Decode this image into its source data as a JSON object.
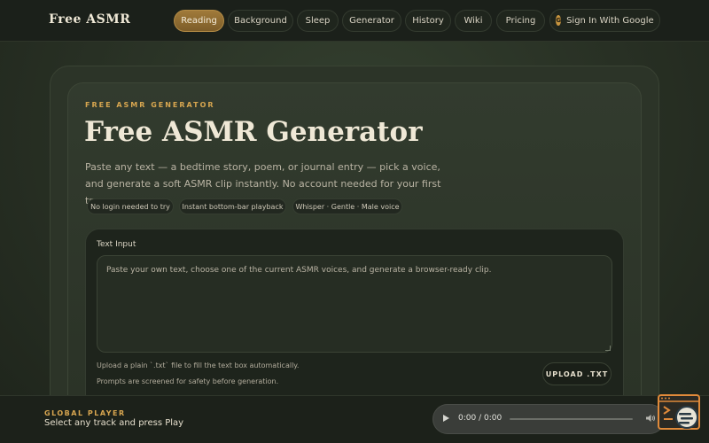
{
  "brand": "Free ASMR",
  "nav": {
    "items": [
      {
        "label": "Reading",
        "active": true
      },
      {
        "label": "Background",
        "active": false
      },
      {
        "label": "Sleep",
        "active": false
      },
      {
        "label": "Generator",
        "active": false
      },
      {
        "label": "History",
        "active": false
      },
      {
        "label": "Wiki",
        "active": false
      },
      {
        "label": "Pricing",
        "active": false
      }
    ],
    "signin": {
      "label": "Sign In With Google",
      "badge": "G"
    }
  },
  "hero": {
    "eyebrow": "FREE ASMR GENERATOR",
    "title": "Free ASMR Generator",
    "description": "Paste any text — a bedtime story, poem, or journal entry — pick a voice, and generate a soft ASMR clip instantly. No account needed for your first try.",
    "chips": [
      "No login needed to try",
      "Instant bottom-bar playback",
      "Whisper · Gentle · Male voice"
    ]
  },
  "input": {
    "label": "Text Input",
    "placeholder": "Paste your own text, choose one of the current ASMR voices, and generate a browser-ready clip.",
    "hint_upload": "Upload a plain `.txt` file to fill the text box automatically.",
    "hint_safety": "Prompts are screened for safety before generation.",
    "upload_button": "UPLOAD .TXT"
  },
  "player": {
    "eyebrow": "GLOBAL PLAYER",
    "status": "Select any track and press Play",
    "time": "0:00 / 0:00"
  },
  "colors": {
    "accent": "#d8a650",
    "active_pill": "#a07a3a",
    "background": "#283024"
  },
  "icons": {
    "play": "play-icon",
    "volume": "volume-icon",
    "widget": "floating-menu-widget-icon"
  }
}
